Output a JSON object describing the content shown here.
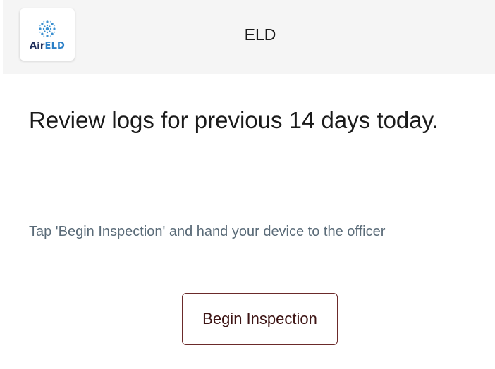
{
  "header": {
    "logo": {
      "icon": "snowflake-icon",
      "text_part1": "Air",
      "text_part2": "ELD",
      "colors": {
        "air": "#1f2f5c",
        "eld": "#2a7fc7"
      }
    },
    "title": "ELD"
  },
  "main": {
    "headline": "Review logs for previous 14 days today.",
    "instruction": "Tap 'Begin Inspection' and hand your device to the officer",
    "button_label": "Begin Inspection"
  },
  "colors": {
    "header_bg": "#f5f5f5",
    "button_border": "#6b2a2a",
    "button_text": "#3d1414",
    "hint_text": "#5a6b78"
  }
}
